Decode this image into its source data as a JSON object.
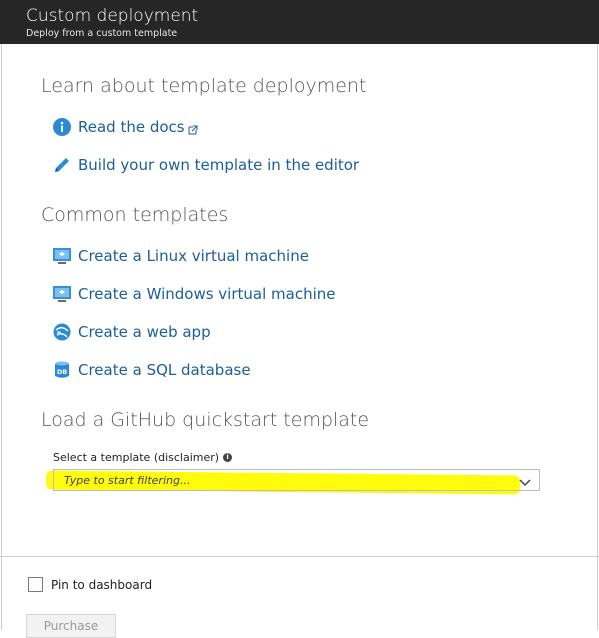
{
  "header": {
    "title": "Custom deployment",
    "subtitle": "Deploy from a custom template"
  },
  "sections": {
    "learn": {
      "title": "Learn about template deployment",
      "links": [
        {
          "label": "Read the docs",
          "icon": "info-icon",
          "external": true
        },
        {
          "label": "Build your own template in the editor",
          "icon": "pencil-icon"
        }
      ]
    },
    "common": {
      "title": "Common templates",
      "links": [
        {
          "label": "Create a Linux virtual machine",
          "icon": "virtual-machine-icon"
        },
        {
          "label": "Create a Windows virtual machine",
          "icon": "virtual-machine-icon"
        },
        {
          "label": "Create a web app",
          "icon": "web-app-icon"
        },
        {
          "label": "Create a SQL database",
          "icon": "sql-database-icon"
        }
      ]
    },
    "github": {
      "title": "Load a GitHub quickstart template",
      "field_label": "Select a template (disclaimer)",
      "placeholder": "Type to start filtering..."
    }
  },
  "footer": {
    "pin_label": "Pin to dashboard",
    "purchase_label": "Purchase"
  },
  "colors": {
    "header_bg": "#262626",
    "link": "#1b5e9e",
    "highlight": "#fffb00"
  }
}
